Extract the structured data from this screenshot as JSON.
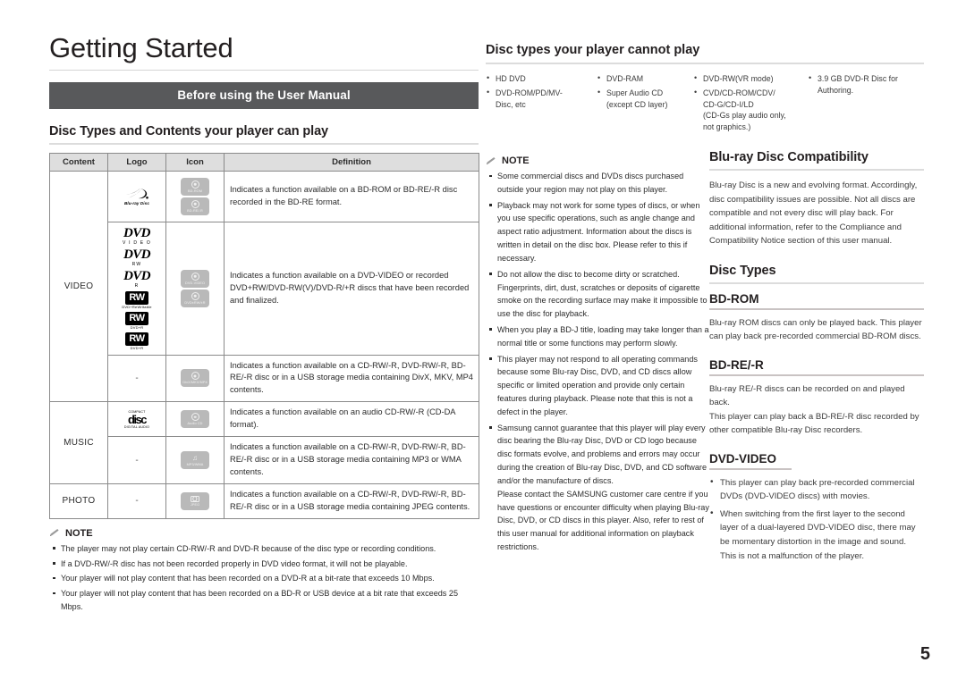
{
  "page": {
    "title": "Getting Started",
    "number": "5"
  },
  "left": {
    "section_bar": "Before using the User Manual",
    "table_heading": "Disc Types and Contents your player can play",
    "table": {
      "columns": [
        "Content",
        "Logo",
        "Icon",
        "Definition"
      ],
      "rows": [
        {
          "content": "",
          "content_rowspan": 3,
          "logo": [
            "blu-ray-disc-logo"
          ],
          "icons": [
            {
              "name": "bd-rom-icon",
              "label": "BD-ROM",
              "glyph": "disc"
            },
            {
              "name": "bd-re-r-icon",
              "label": "BD-RE/-R",
              "glyph": "disc"
            }
          ],
          "definition": "Indicates a function available on a BD-ROM or BD-RE/-R disc recorded in the BD-RE format."
        },
        {
          "content": "VIDEO",
          "logo": [
            "dvd-video-logo",
            "dvd-rw-logo",
            "dvd-r-logo",
            "dvd-rw-rerecordable-logo",
            "dvd-plus-r-logo",
            "dvd-plus-rw-logo"
          ],
          "icons": [
            {
              "name": "dvd-video-icon",
              "label": "DVD-VIDEO",
              "glyph": "disc"
            },
            {
              "name": "dvd-rw-r-icon",
              "label": "DVD±RW/±R",
              "glyph": "disc"
            }
          ],
          "definition": "Indicates a function available on a DVD-VIDEO or recorded DVD+RW/DVD-RW(V)/DVD-R/+R discs that have been recorded and finalized."
        },
        {
          "content": "",
          "logo": [
            "-"
          ],
          "icons": [
            {
              "name": "divx-mkv-mp4-icon",
              "label": "DivX/MKV/MP4",
              "glyph": "film"
            }
          ],
          "definition": "Indicates a function available on a CD-RW/-R, DVD-RW/-R, BD-RE/-R disc or in a USB storage media containing DivX, MKV, MP4 contents."
        },
        {
          "content": "MUSIC",
          "content_rowspan": 2,
          "logo": [
            "compact-disc-digital-audio-logo"
          ],
          "icons": [
            {
              "name": "audio-cd-icon",
              "label": "Audio CD",
              "glyph": "disc"
            }
          ],
          "definition": "Indicates a function available on an audio CD-RW/-R (CD-DA format)."
        },
        {
          "content": "",
          "logo": [
            "-"
          ],
          "icons": [
            {
              "name": "mp3-wma-icon",
              "label": "MP3/WMA",
              "glyph": "note"
            }
          ],
          "definition": "Indicates a function available on a CD-RW/-R, DVD-RW/-R, BD-RE/-R disc or in a USB storage media containing MP3 or WMA contents."
        },
        {
          "content": "PHOTO",
          "logo": [
            "-"
          ],
          "icons": [
            {
              "name": "jpeg-icon",
              "label": "JPEG",
              "glyph": "camera"
            }
          ],
          "definition": "Indicates a function available on a CD-RW/-R, DVD-RW/-R, BD-RE/-R disc or in a USB storage media containing JPEG contents."
        }
      ]
    },
    "note": {
      "title": "NOTE",
      "items": [
        "The player may not play certain CD-RW/-R and DVD-R because of the disc type or recording conditions.",
        "If a DVD-RW/-R disc has not been recorded properly in DVD video format, it will not be playable.",
        "Your player will not play content that has been recorded on a DVD-R at a bit-rate that exceeds 10 Mbps.",
        "Your player will not play content that has been recorded on a BD-R or USB device at a bit rate that exceeds 25 Mbps."
      ]
    }
  },
  "cannot_play": {
    "heading": "Disc types your player cannot play",
    "columns": [
      [
        "HD DVD",
        "DVD-ROM/PD/MV-Disc, etc"
      ],
      [
        "DVD-RAM",
        "Super Audio CD (except CD layer)"
      ],
      [
        "DVD-RW(VR mode)",
        "CVD/CD-ROM/CDV/CD-G/CD-I/LD (CD-Gs play audio only, not graphics.)"
      ],
      [
        "3.9 GB DVD-R Disc for Authoring."
      ]
    ],
    "col1": {
      "i0": "HD DVD",
      "i1a": "DVD-ROM/PD/MV-",
      "i1b": "Disc, etc"
    },
    "col2": {
      "i0": "DVD-RAM",
      "i1a": "Super Audio CD",
      "i1b": "(except CD layer)"
    },
    "col3": {
      "i0": "DVD-RW(VR mode)",
      "i1a": "CVD/CD-ROM/CDV/",
      "i1b": "CD-G/CD-I/LD",
      "i1c": "(CD-Gs play audio only,",
      "i1d": "not graphics.)"
    },
    "col4": {
      "i0a": "3.9 GB DVD-R Disc for",
      "i0b": "Authoring."
    }
  },
  "mid_note": {
    "title": "NOTE",
    "items": [
      "Some commercial discs and DVDs discs purchased outside your region may not play on this player.",
      "Playback may not work for some types of discs, or when you use specific operations, such as angle change and aspect ratio adjustment. Information about the discs is written in detail on the disc box. Please refer to this if necessary.",
      "Do not allow the disc to become dirty or scratched. Fingerprints, dirt, dust, scratches or deposits of cigarette smoke on the recording surface may make it impossible to use the disc for playback.",
      "When you play a BD-J title, loading may take longer than a normal title or some functions may perform slowly.",
      "This player may not respond to all operating commands because some Blu-ray Disc, DVD, and CD discs allow specific or limited operation and provide only certain features during playback. Please note that this is not a defect in the player.",
      "Samsung cannot guarantee that this player will play every disc bearing the Blu-ray Disc, DVD or CD logo because disc formats evolve, and problems and errors may occur during the creation of Blu-ray Disc, DVD, and CD software and/or the manufacture of discs.\nPlease contact the SAMSUNG customer care centre if you have questions or encounter difficulty when playing Blu-ray Disc, DVD, or CD discs in this player. Also, refer to rest of this user manual for additional information on playback restrictions."
    ]
  },
  "right": {
    "compatibility": {
      "heading": "Blu-ray Disc Compatibility",
      "body": "Blu-ray Disc is a new and evolving format. Accordingly, disc compatibility issues are possible. Not all discs are compatible and not every disc will play back. For additional information, refer to the Compliance and Compatibility Notice section of this user manual."
    },
    "disc_types_heading": "Disc Types",
    "bd_rom": {
      "heading": "BD-ROM",
      "body": "Blu-ray ROM discs can only be played back. This player can play back pre-recorded commercial BD-ROM discs."
    },
    "bd_re_r": {
      "heading": "BD-RE/-R",
      "body": "Blu-ray RE/-R discs can be recorded on and played back.\nThis player can play back a BD-RE/-R disc recorded by other compatible Blu-ray Disc recorders."
    },
    "dvd_video": {
      "heading": "DVD-VIDEO",
      "items": [
        "This player can play back pre-recorded commercial DVDs (DVD-VIDEO discs) with movies.",
        "When switching from the first layer to the second layer of a dual-layered DVD-VIDEO disc, there may be momentary distortion in the image and sound. This is not a malfunction of the player."
      ]
    }
  },
  "colors": {
    "bar_bg": "#58595b",
    "table_header_bg": "#dedede",
    "chip_bg": "#b9b9b9",
    "text": "#231f20"
  }
}
